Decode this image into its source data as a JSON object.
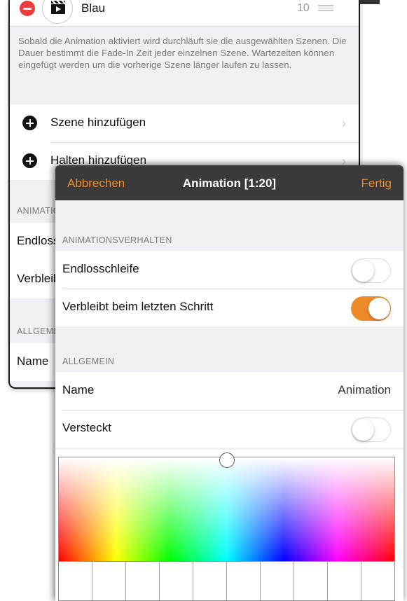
{
  "back_screen": {
    "scene": {
      "name": "Blau",
      "count": "10"
    },
    "description": "Sobald die Animation aktiviert wird durchläuft sie die ausgewählten Szenen. Die Dauer bestimmt die Fade-In Zeit jeder einzelnen Szene. Wartezeiten können eingefügt werden um die vorherige Szene länger laufen zu lassen.",
    "actions": [
      {
        "label": "Szene hinzufügen"
      },
      {
        "label": "Halten hinzufügen"
      }
    ],
    "behavior_header": "ANIMATIONSVERHALTEN",
    "behavior_rows": [
      "Endlosschleife",
      "Verbleibt beim letzten Schritt"
    ],
    "general_header": "ALLGEMEIN",
    "general_rows": [
      "Name"
    ]
  },
  "modal": {
    "nav": {
      "cancel": "Abbrechen",
      "title": "Animation [1:20]",
      "done": "Fertig"
    },
    "behavior": {
      "header": "ANIMATIONSVERHALTEN",
      "rows": [
        {
          "label": "Endlosschleife",
          "on": false
        },
        {
          "label": "Verbleibt beim letzten Schritt",
          "on": true
        }
      ]
    },
    "general": {
      "header": "ALLGEMEIN",
      "name_label": "Name",
      "name_value": "Animation",
      "hidden_label": "Versteckt",
      "hidden_on": false
    },
    "color_picker": {
      "swatch_count": 10
    }
  },
  "colors": {
    "accent": "#ee8a2a",
    "navbar": "#3a3a3c",
    "delete": "#ee3c3c",
    "grouped_bg": "#efeff4"
  },
  "icons": [
    "minus-circle-icon",
    "clapperboard-icon",
    "drag-handle-icon",
    "plus-circle-icon",
    "chevron-right-icon"
  ]
}
